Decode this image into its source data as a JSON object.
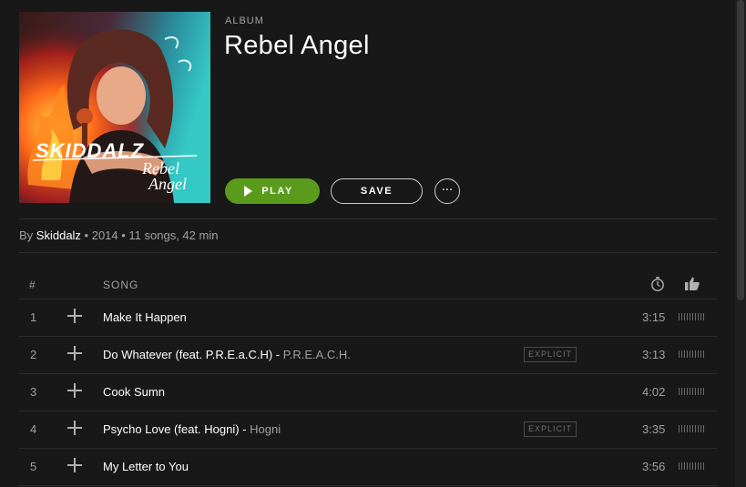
{
  "album": {
    "type_label": "ALBUM",
    "title": "Rebel Angel",
    "cover_text_artist": "SKIDDALZ",
    "cover_text_title_1": "Rebel",
    "cover_text_title_2": "Angel"
  },
  "actions": {
    "play_label": "PLAY",
    "save_label": "SAVE",
    "more_label": "···"
  },
  "meta": {
    "by": "By ",
    "artist": "Skiddalz",
    "details": " • 2014 • 11 songs, 42 min"
  },
  "table": {
    "col_num": "#",
    "col_song": "SONG",
    "duration_icon": "stopwatch-icon",
    "popularity_icon": "thumbs-up-icon"
  },
  "tracks": [
    {
      "num": "1",
      "title": "Make It Happen",
      "sep": "",
      "feat_artist": "",
      "explicit": "",
      "duration": "3:15"
    },
    {
      "num": "2",
      "title": "Do Whatever (feat. P.R.E.a.C.H)",
      "sep": " - ",
      "feat_artist": "P.R.E.A.C.H.",
      "explicit": "EXPLICIT",
      "duration": "3:13"
    },
    {
      "num": "3",
      "title": "Cook Sumn",
      "sep": "",
      "feat_artist": "",
      "explicit": "",
      "duration": "4:02"
    },
    {
      "num": "4",
      "title": "Psycho Love (feat. Hogni)",
      "sep": " - ",
      "feat_artist": "Hogni",
      "explicit": "EXPLICIT",
      "duration": "3:35"
    },
    {
      "num": "5",
      "title": "My Letter to You",
      "sep": "",
      "feat_artist": "",
      "explicit": "",
      "duration": "3:56"
    }
  ],
  "colors": {
    "background": "#181818",
    "accent_play": "#5b9b1c",
    "text_secondary": "#a0a0a0"
  }
}
